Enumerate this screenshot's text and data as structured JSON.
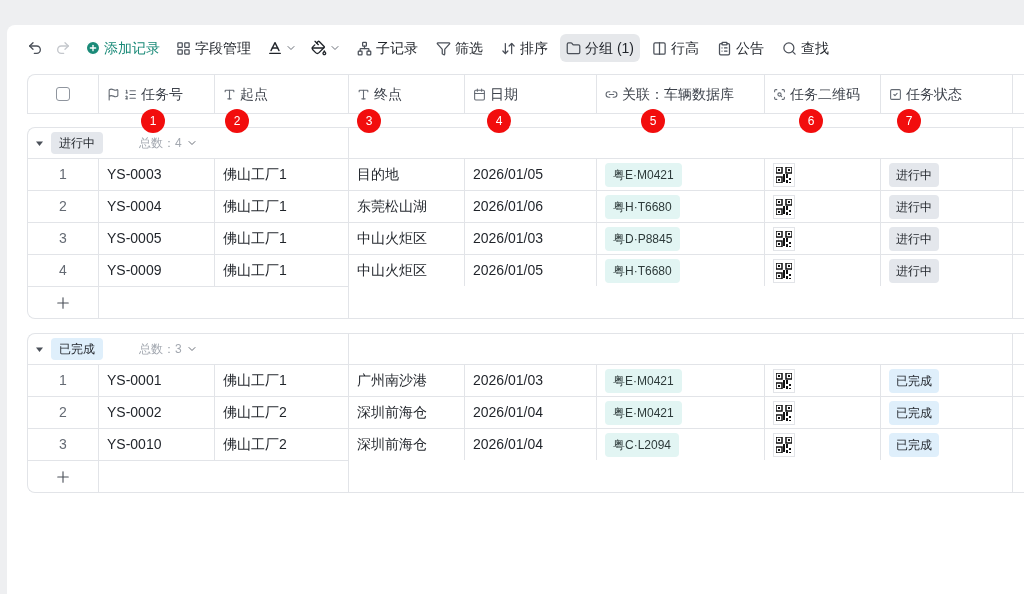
{
  "toolbar": {
    "undo": {
      "disabled": false
    },
    "redo": {
      "disabled": true
    },
    "items": [
      {
        "kind": "primary",
        "label": "添加记录",
        "selected": false
      },
      {
        "kind": "button",
        "label": "字段管理",
        "selected": false
      },
      {
        "kind": "text_color"
      },
      {
        "kind": "fill_color"
      },
      {
        "kind": "button",
        "label": "子记录",
        "selected": false
      },
      {
        "kind": "button",
        "label": "筛选",
        "selected": false
      },
      {
        "kind": "button",
        "label": "排序",
        "selected": false
      },
      {
        "kind": "button",
        "label": "分组 (1)",
        "selected": true
      },
      {
        "kind": "button",
        "label": "行高",
        "selected": false
      },
      {
        "kind": "button",
        "label": "公告",
        "selected": false
      },
      {
        "kind": "button",
        "label": "查找",
        "selected": false
      }
    ]
  },
  "select_all": {
    "checked": false
  },
  "columns": [
    "任务号",
    "起点",
    "终点",
    "日期",
    "关联：车辆数据库",
    "任务二维码",
    "任务状态"
  ],
  "markers": [
    "1",
    "2",
    "3",
    "4",
    "5",
    "6",
    "7"
  ],
  "groups": [
    {
      "label": "进行中",
      "color": "#e4e7ec",
      "count_label": "总数：4",
      "expanded": true,
      "rows": [
        {
          "index": "1",
          "task": "YS-0003",
          "origin": "佛山工厂1",
          "destination": "目的地",
          "date": "2026/01/05",
          "vehicle": "粤E·M0421",
          "status": "进行中"
        },
        {
          "index": "2",
          "task": "YS-0004",
          "origin": "佛山工厂1",
          "destination": "东莞松山湖",
          "date": "2026/01/06",
          "vehicle": "粤H·T6680",
          "status": "进行中"
        },
        {
          "index": "3",
          "task": "YS-0005",
          "origin": "佛山工厂1",
          "destination": "中山火炬区",
          "date": "2026/01/03",
          "vehicle": "粤D·P8845",
          "status": "进行中"
        },
        {
          "index": "4",
          "task": "YS-0009",
          "origin": "佛山工厂1",
          "destination": "中山火炬区",
          "date": "2026/01/05",
          "vehicle": "粤H·T6680",
          "status": "进行中"
        }
      ]
    },
    {
      "label": "已完成",
      "color": "#dfeffb",
      "count_label": "总数：3",
      "expanded": true,
      "rows": [
        {
          "index": "1",
          "task": "YS-0001",
          "origin": "佛山工厂1",
          "destination": "广州南沙港",
          "date": "2026/01/03",
          "vehicle": "粤E·M0421",
          "status": "已完成"
        },
        {
          "index": "2",
          "task": "YS-0002",
          "origin": "佛山工厂2",
          "destination": "深圳前海仓",
          "date": "2026/01/04",
          "vehicle": "粤E·M0421",
          "status": "已完成"
        },
        {
          "index": "3",
          "task": "YS-0010",
          "origin": "佛山工厂2",
          "destination": "深圳前海仓",
          "date": "2026/01/04",
          "vehicle": "粤C·L2094",
          "status": "已完成"
        }
      ]
    }
  ]
}
